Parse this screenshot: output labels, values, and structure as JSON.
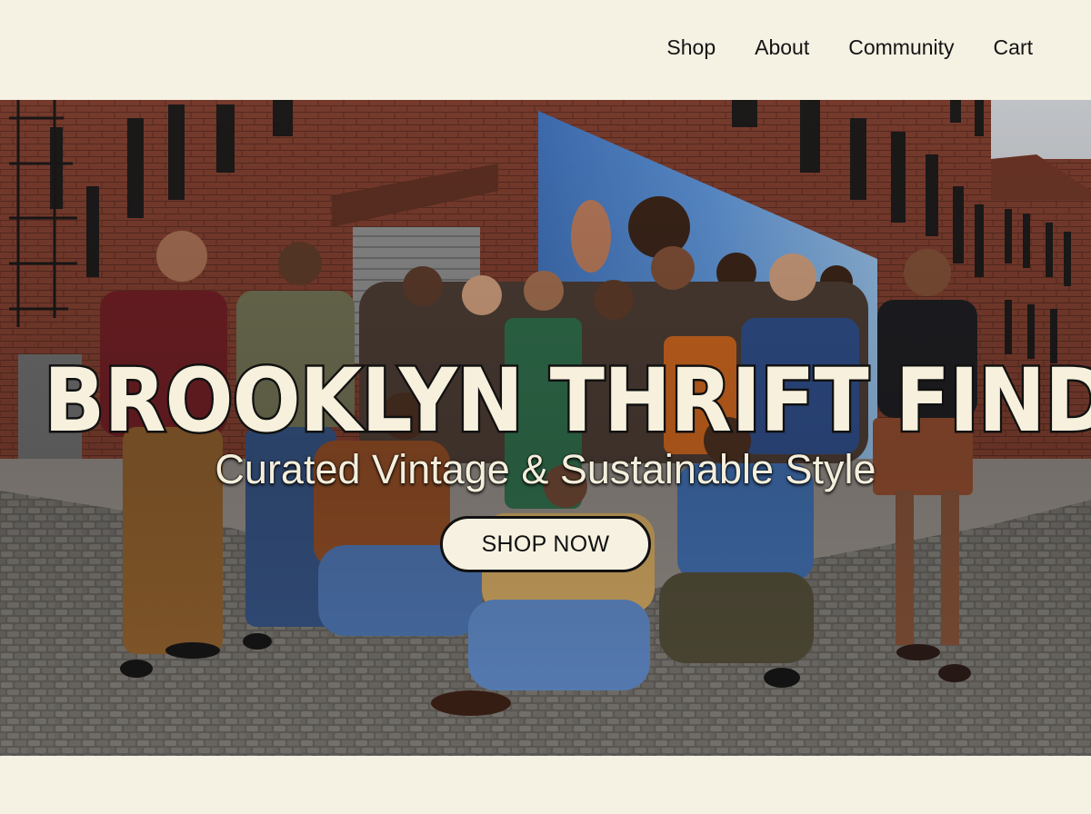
{
  "nav": {
    "items": [
      "Shop",
      "About",
      "Community",
      "Cart"
    ]
  },
  "hero": {
    "title": "BROOKLYN THRIFT FINDS",
    "subtitle": "Curated Vintage & Sustainable Style",
    "cta_label": "SHOP NOW",
    "photo_subject": "group of young people in vintage clothing on a cobblestone Brooklyn street"
  },
  "colors": {
    "background": "#f5f1e3",
    "title_fill": "#f6f0dc",
    "title_stroke": "#111111",
    "brick": "#7a3b2c"
  }
}
